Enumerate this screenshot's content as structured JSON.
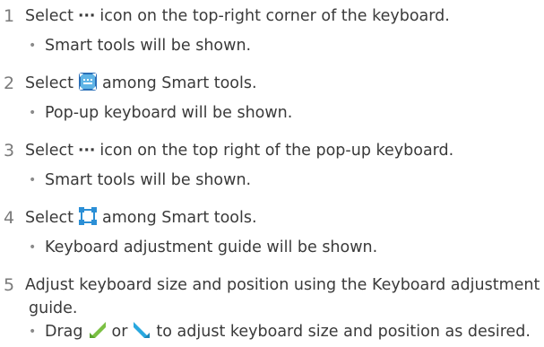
{
  "steps": [
    {
      "number": "1",
      "before": "Select",
      "icon": "more-dots-icon",
      "after": "icon on the top-right corner of the keyboard.",
      "bullet": "Smart tools will be shown."
    },
    {
      "number": "2",
      "before": "Select",
      "icon": "popup-keyboard-icon",
      "after": "among Smart tools.",
      "bullet": "Pop-up keyboard will be shown."
    },
    {
      "number": "3",
      "before": "Select",
      "icon": "more-dots-icon",
      "after": "icon on the top right of the pop-up keyboard.",
      "bullet": "Smart tools will be shown."
    },
    {
      "number": "4",
      "before": "Select",
      "icon": "keyboard-adjust-icon",
      "after": "among Smart tools.",
      "bullet": "Keyboard adjustment guide will be shown."
    },
    {
      "number": "5",
      "line1": "Adjust keyboard size and position using the Keyboard adjustment",
      "line2": "guide.",
      "bullet_before": "Drag",
      "bullet_icon1": "bottom-left-corner-handle-icon",
      "bullet_or": "or",
      "bullet_icon2": "bottom-right-corner-handle-icon",
      "bullet_after": "to adjust keyboard size and position as desired."
    }
  ],
  "dots_glyph": "···",
  "colors": {
    "text": "#3a3a3a",
    "step_number": "#7a7a7a",
    "icon_blue_dark": "#2a6fb8",
    "icon_blue_light": "#5fb4e6",
    "handle_green": "#7bc043",
    "handle_blue": "#29a8df",
    "adjust_blue": "#2b8fd6"
  }
}
